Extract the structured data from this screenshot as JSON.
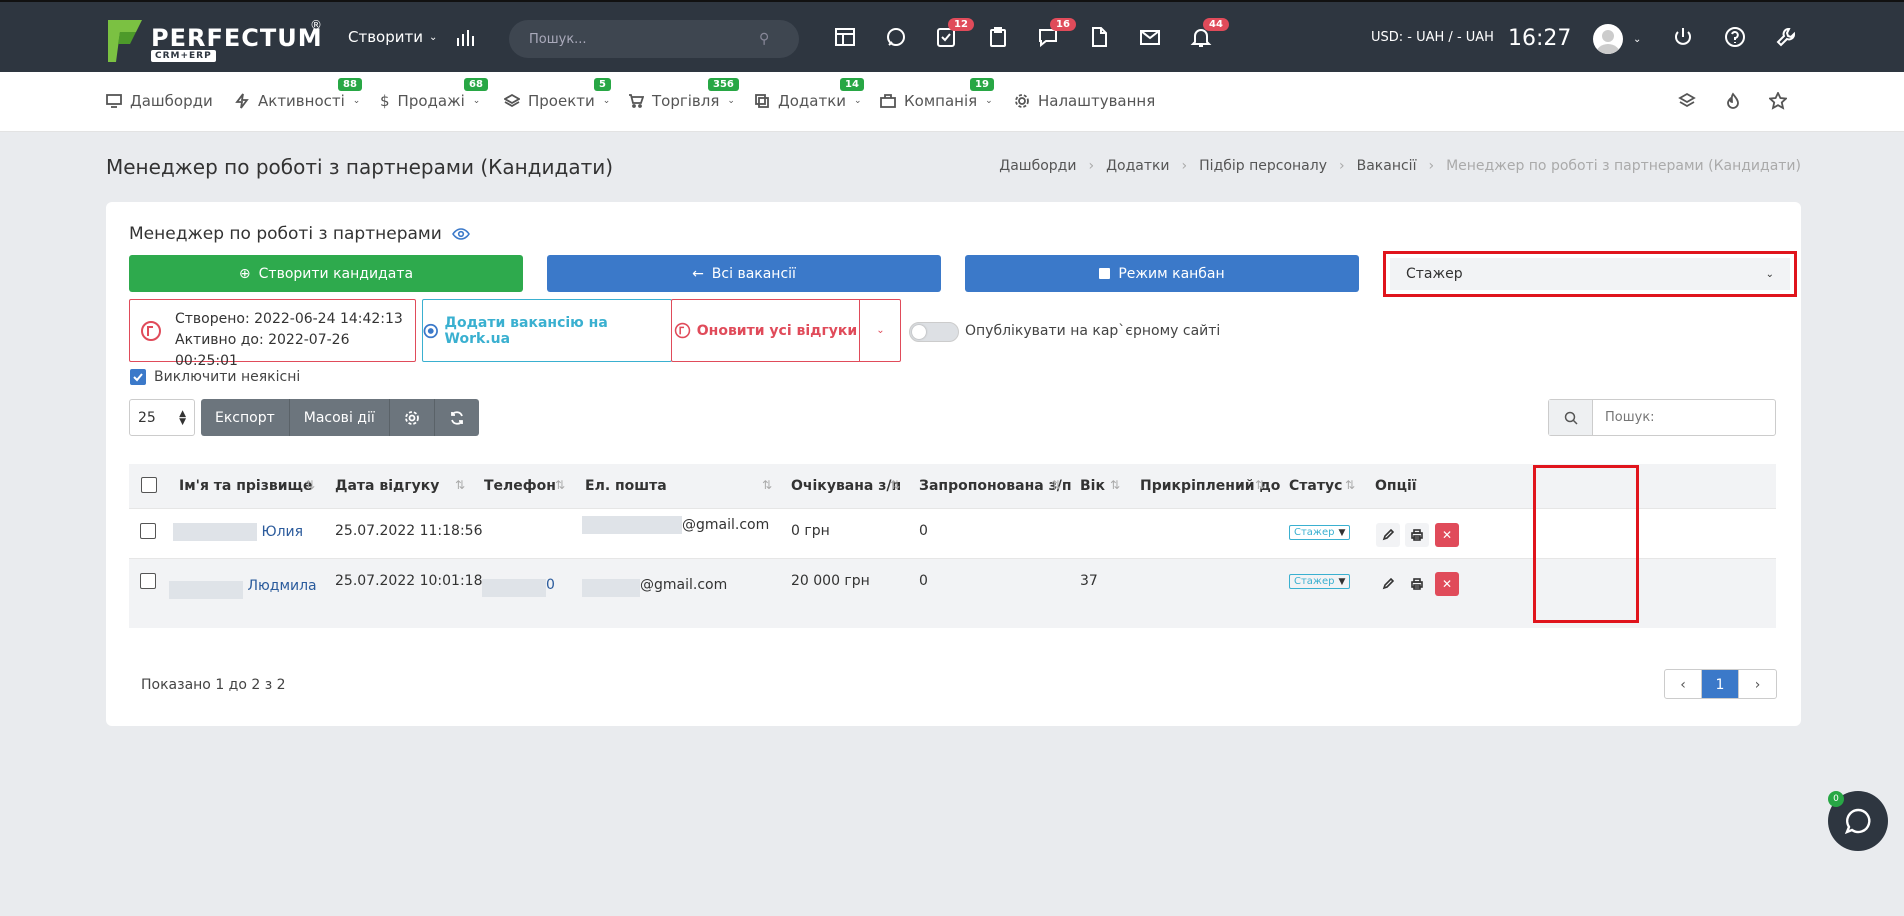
{
  "topbar": {
    "logo_word": "PERFECTUM",
    "logo_reg": "®",
    "logo_sub": "CRM+ERP",
    "create_label": "Створити",
    "search_placeholder": "Пошук...",
    "badges": {
      "tasks": "12",
      "messages": "16",
      "notifications": "44"
    },
    "currency": "USD: - UAH / - UAH",
    "time": "16:27"
  },
  "nav": {
    "items": [
      {
        "label": "Дашборди",
        "icon": "monitor-icon",
        "badge": ""
      },
      {
        "label": "Активності",
        "icon": "bolt-icon",
        "badge": "88"
      },
      {
        "label": "Продажі",
        "icon": "dollar-icon",
        "badge": "68"
      },
      {
        "label": "Проекти",
        "icon": "layers-icon",
        "badge": "5"
      },
      {
        "label": "Торгівля",
        "icon": "cart-icon",
        "badge": "356"
      },
      {
        "label": "Додатки",
        "icon": "copy-icon",
        "badge": "14"
      },
      {
        "label": "Компанія",
        "icon": "briefcase-icon",
        "badge": "19"
      },
      {
        "label": "Налаштування",
        "icon": "gear-icon",
        "badge": ""
      }
    ]
  },
  "page": {
    "title": "Менеджер по роботі з партнерами (Кандидати)",
    "breadcrumb": [
      "Дашборди",
      "Додатки",
      "Підбір персоналу",
      "Вакансії",
      "Менеджер по роботі з партнерами (Кандидати)"
    ]
  },
  "card": {
    "title": "Менеджер по роботі з партнерами",
    "create_candidate": "Створити кандидата",
    "all_vacancies": "Всі вакансії",
    "kanban_mode": "Режим канбан",
    "stage_selected": "Стажер",
    "created": "Створено: 2022-06-24 14:42:13",
    "active_until": "Активно до: 2022-07-26 00:25:01",
    "add_workua": "Додати вакансію на Work.ua",
    "update_responses": "Оновити усі відгуки",
    "publish_label": "Опублікувати на кар`єрному сайті",
    "exclude_label": "Виключити неякісні",
    "page_size": "25",
    "export": "Експорт",
    "mass_actions": "Масові дії",
    "search_placeholder": "Пошук:"
  },
  "table": {
    "headers": [
      "Ім'я та прізвище",
      "Дата відгуку",
      "Телефон",
      "Ел. пошта",
      "Очікувана з/п",
      "Запропонована з/п",
      "Вік",
      "Прикріплений до",
      "Статус",
      "Опції"
    ],
    "rows": [
      {
        "name": "Юлия",
        "date": "25.07.2022 11:18:56",
        "phone": "",
        "email": "@gmail.com",
        "expected": "0 грн",
        "offered": "0",
        "age": "",
        "attached": "",
        "status": "Стажер"
      },
      {
        "name": "Людмила",
        "date": "25.07.2022 10:01:18",
        "phone": "0",
        "email": "@gmail.com",
        "expected": "20 000 грн",
        "offered": "0",
        "age": "37",
        "attached": "",
        "status": "Стажер"
      }
    ]
  },
  "footer": {
    "showing": "Показано 1 до 2 з 2",
    "current_page": "1",
    "prev": "‹",
    "next": "›"
  },
  "chat": {
    "badge": "0"
  },
  "colors": {
    "topbar": "#2e3640",
    "green": "#2eaa4d",
    "blue": "#3b79c9",
    "red": "#e04b5a",
    "highlight": "#e0141c"
  }
}
